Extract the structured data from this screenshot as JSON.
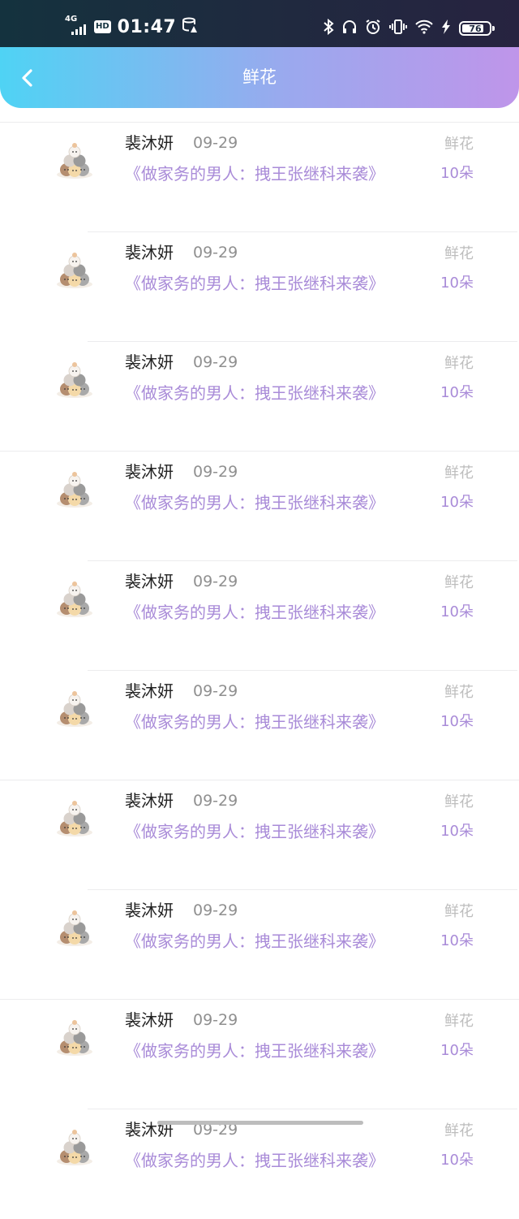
{
  "status_bar": {
    "network": "4G",
    "hd": "HD",
    "time": "01:47",
    "battery": "76",
    "icons": [
      "signal-icon",
      "data-saver-icon",
      "bluetooth-icon",
      "headphones-icon",
      "alarm-icon",
      "vibrate-icon",
      "wifi-icon",
      "charging-icon",
      "battery-icon"
    ]
  },
  "header": {
    "title": "鲜花",
    "back_icon": "chevron-left-icon"
  },
  "list": {
    "items": [
      {
        "name": "裴沐妍",
        "date": "09-29",
        "work": "《做家务的男人：拽王张继科来袭》",
        "type": "鲜花",
        "amount": "10朵"
      },
      {
        "name": "裴沐妍",
        "date": "09-29",
        "work": "《做家务的男人：拽王张继科来袭》",
        "type": "鲜花",
        "amount": "10朵"
      },
      {
        "name": "裴沐妍",
        "date": "09-29",
        "work": "《做家务的男人：拽王张继科来袭》",
        "type": "鲜花",
        "amount": "10朵"
      },
      {
        "name": "裴沐妍",
        "date": "09-29",
        "work": "《做家务的男人：拽王张继科来袭》",
        "type": "鲜花",
        "amount": "10朵"
      },
      {
        "name": "裴沐妍",
        "date": "09-29",
        "work": "《做家务的男人：拽王张继科来袭》",
        "type": "鲜花",
        "amount": "10朵"
      },
      {
        "name": "裴沐妍",
        "date": "09-29",
        "work": "《做家务的男人：拽王张继科来袭》",
        "type": "鲜花",
        "amount": "10朵"
      },
      {
        "name": "裴沐妍",
        "date": "09-29",
        "work": "《做家务的男人：拽王张继科来袭》",
        "type": "鲜花",
        "amount": "10朵"
      },
      {
        "name": "裴沐妍",
        "date": "09-29",
        "work": "《做家务的男人：拽王张继科来袭》",
        "type": "鲜花",
        "amount": "10朵"
      },
      {
        "name": "裴沐妍",
        "date": "09-29",
        "work": "《做家务的男人：拽王张继科来袭》",
        "type": "鲜花",
        "amount": "10朵"
      },
      {
        "name": "裴沐妍",
        "date": "09-29",
        "work": "《做家务的男人：拽王张继科来袭》",
        "type": "鲜花",
        "amount": "10朵"
      }
    ]
  },
  "colors": {
    "accent_purple": "#a98bd8",
    "header_gradient_start": "#4fd3f4",
    "header_gradient_end": "#bf95ea"
  }
}
